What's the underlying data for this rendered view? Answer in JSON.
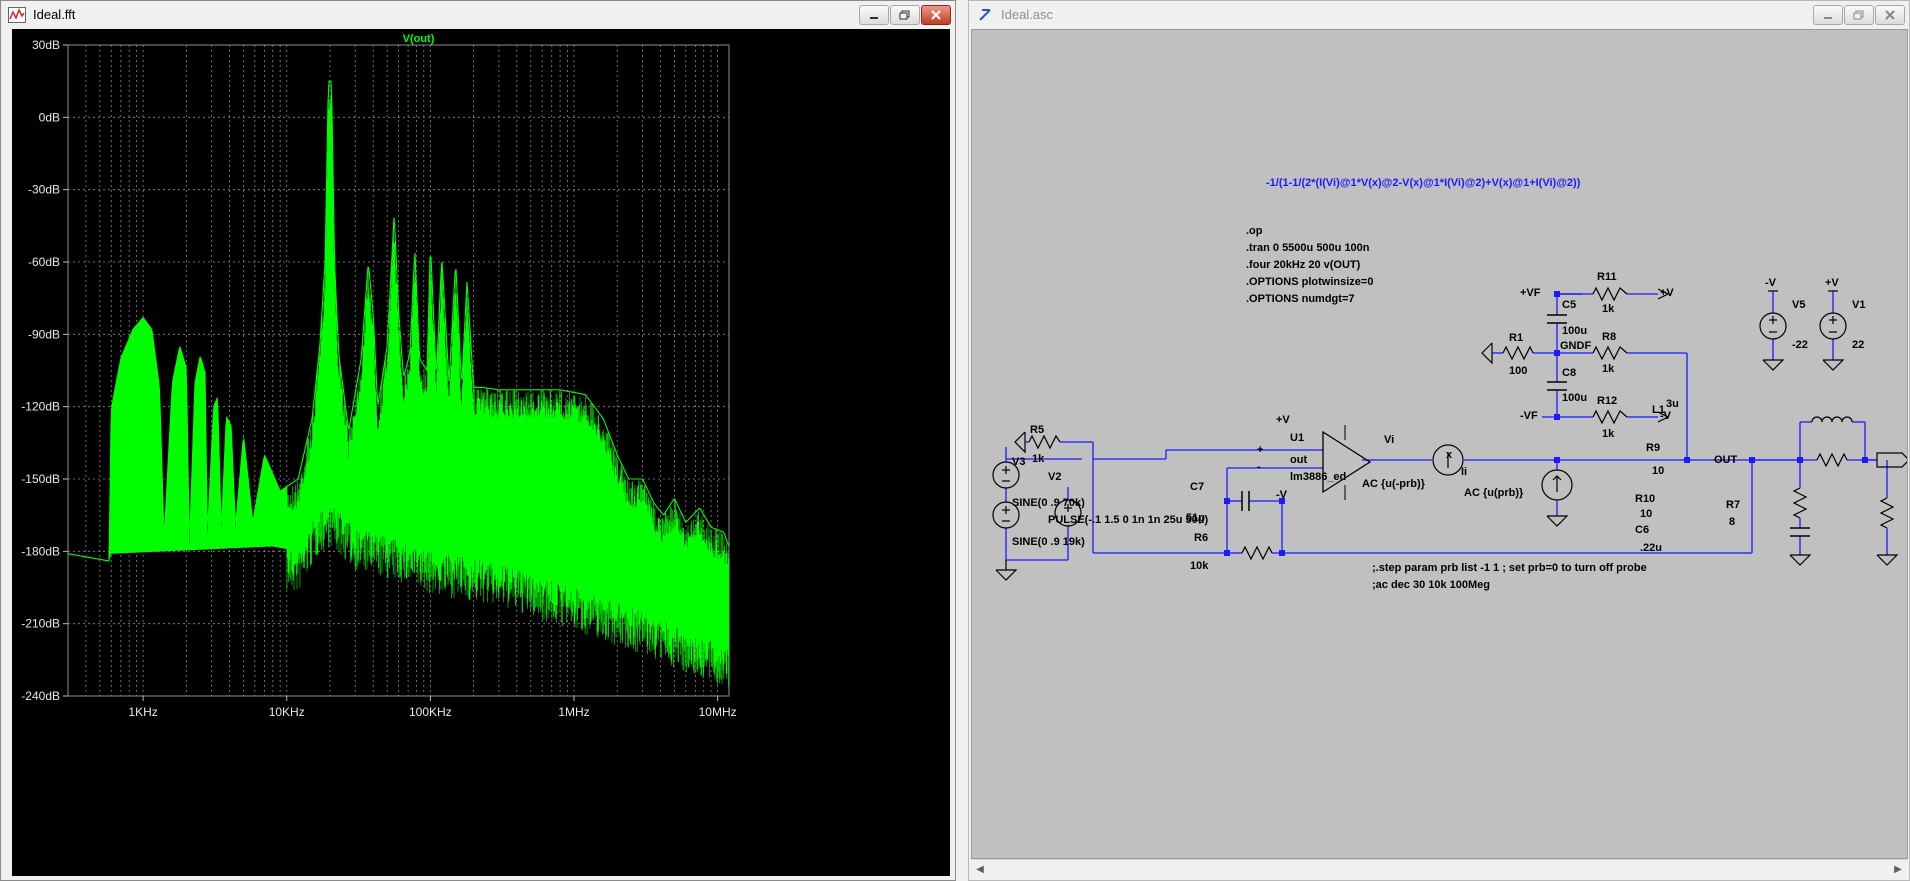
{
  "fft_window": {
    "title": "Ideal.fft",
    "icon": "waveform-icon",
    "buttons": [
      "minimize",
      "maximize",
      "close"
    ]
  },
  "schematic_window": {
    "title": "Ideal.asc",
    "icon": "ltspice-icon",
    "buttons": [
      "minimize",
      "maximize",
      "close"
    ]
  },
  "colors": {
    "trace": "#00ff00",
    "plot_bg": "#000000",
    "grid": "#808080",
    "schematic_bg": "#c0c0c0",
    "wire": "#1a1aff"
  },
  "chart_data": {
    "type": "line",
    "title": "V(out)",
    "series": [
      {
        "name": "V(out)",
        "x_unit": "Hz",
        "y_unit": "dB"
      }
    ],
    "x_scale": "log",
    "xlim": [
      300,
      12000000
    ],
    "ylim": [
      -240,
      30
    ],
    "x_ticks": [
      1000,
      10000,
      100000,
      1000000,
      10000000
    ],
    "x_tick_labels": [
      "1KHz",
      "10KHz",
      "100KHz",
      "1MHz",
      "10MHz"
    ],
    "y_ticks": [
      30,
      0,
      -30,
      -60,
      -90,
      -120,
      -150,
      -180,
      -210,
      -240
    ],
    "y_tick_labels": [
      "30dB",
      "0dB",
      "-30dB",
      "-60dB",
      "-90dB",
      "-120dB",
      "-150dB",
      "-180dB",
      "-210dB",
      "-240dB"
    ],
    "grid": true,
    "legend_placement": "top-center",
    "envelope": [
      [
        300,
        -181
      ],
      [
        580,
        -184
      ],
      [
        600,
        -121
      ],
      [
        700,
        -100
      ],
      [
        850,
        -88
      ],
      [
        1000,
        -83
      ],
      [
        1150,
        -88
      ],
      [
        1300,
        -112
      ],
      [
        1400,
        -175
      ],
      [
        1600,
        -110
      ],
      [
        1800,
        -95
      ],
      [
        2000,
        -104
      ],
      [
        2100,
        -178
      ],
      [
        2300,
        -110
      ],
      [
        2500,
        -99
      ],
      [
        2700,
        -106
      ],
      [
        2800,
        -174
      ],
      [
        3100,
        -120
      ],
      [
        3300,
        -116
      ],
      [
        3500,
        -172
      ],
      [
        3800,
        -124
      ],
      [
        4100,
        -128
      ],
      [
        4400,
        -170
      ],
      [
        5000,
        -132
      ],
      [
        5800,
        -168
      ],
      [
        7000,
        -140
      ],
      [
        9000,
        -155
      ],
      [
        12000,
        -150
      ],
      [
        15000,
        -125
      ],
      [
        17000,
        -95
      ],
      [
        18500,
        -60
      ],
      [
        19500,
        15
      ],
      [
        20500,
        15
      ],
      [
        21500,
        -60
      ],
      [
        23000,
        -98
      ],
      [
        27000,
        -130
      ],
      [
        33000,
        -100
      ],
      [
        37000,
        -60
      ],
      [
        40000,
        -82
      ],
      [
        43000,
        -120
      ],
      [
        50000,
        -95
      ],
      [
        56000,
        -40
      ],
      [
        60000,
        -80
      ],
      [
        65000,
        -108
      ],
      [
        72000,
        -98
      ],
      [
        78000,
        -55
      ],
      [
        84000,
        -100
      ],
      [
        95000,
        -105
      ],
      [
        100000,
        -52
      ],
      [
        110000,
        -108
      ],
      [
        120000,
        -58
      ],
      [
        135000,
        -110
      ],
      [
        150000,
        -60
      ],
      [
        165000,
        -112
      ],
      [
        180000,
        -68
      ],
      [
        200000,
        -112
      ],
      [
        230000,
        -112
      ],
      [
        300000,
        -113
      ],
      [
        500000,
        -113
      ],
      [
        800000,
        -113
      ],
      [
        1200000,
        -115
      ],
      [
        1600000,
        -125
      ],
      [
        2000000,
        -140
      ],
      [
        2400000,
        -150
      ],
      [
        3000000,
        -150
      ],
      [
        3600000,
        -160
      ],
      [
        4200000,
        -165
      ],
      [
        5000000,
        -158
      ],
      [
        6000000,
        -168
      ],
      [
        7500000,
        -162
      ],
      [
        9000000,
        -170
      ],
      [
        11000000,
        -172
      ],
      [
        12000000,
        -178
      ]
    ],
    "floor": [
      [
        300,
        -181
      ],
      [
        580,
        -184
      ],
      [
        600,
        -181
      ],
      [
        8000,
        -178
      ],
      [
        12000,
        -180
      ],
      [
        16000,
        -165
      ],
      [
        20000,
        -160
      ],
      [
        30000,
        -170
      ],
      [
        60000,
        -175
      ],
      [
        100000,
        -180
      ],
      [
        300000,
        -185
      ],
      [
        1000000,
        -195
      ],
      [
        3000000,
        -205
      ],
      [
        12000000,
        -220
      ]
    ]
  },
  "schematic": {
    "directives": [
      ".op",
      ".tran 0 5500u 500u 100n",
      ".four 20kHz 20 v(OUT)",
      ".OPTIONS plotwinsize=0",
      ".OPTIONS numdgt=7"
    ],
    "expression": "-1/(1-1/(2*(I(Vi)@1*V(x)@2-V(x)@1*I(Vi)@2)+V(x)@1+I(Vi)@2))",
    "comment_step": ";.step param prb list -1 1 ; set prb=0 to turn off probe",
    "comment_ac": ";ac dec 30 10k 100Meg",
    "labels": {
      "r11": "R11",
      "r11v": "1k",
      "vf_pos": "+VF",
      "v_pos": "+V",
      "c5": "C5",
      "c5v": "100u",
      "r1": "R1",
      "r1v": "100",
      "gndf": "GNDF",
      "r8": "R8",
      "r8v": "1k",
      "c8": "C8",
      "c8v": "100u",
      "r12": "R12",
      "r12v": "1k",
      "vf_neg": "-VF",
      "v_neg": "-V",
      "v5": "V5",
      "v5v": "-22",
      "v1": "V1",
      "v1v": "22",
      "v5top": "-V",
      "v1top": "+V",
      "r5": "R5",
      "r5v": "1k",
      "u1": "U1",
      "u1v": "lm3886_ed",
      "out_pin": "out",
      "plus": "+",
      "minus": "-",
      "vplus": "+V",
      "vminus": "-V",
      "vi": "Vi",
      "vi_ac": "AC {u(-prb)}",
      "x": "x",
      "ii": "Ii",
      "ii_ac": "AC {u(prb)}",
      "l1": "L1",
      "l1v": "3u",
      "r9": "R9",
      "r9v": "10",
      "out_flag": "OUT",
      "v3": "V3",
      "v3v": "SINE(0 .9 70k)",
      "v2": "V2",
      "v2v": "PULSE(-.1 1.5 0 1n 1n 25u 50u)",
      "v_sine2": "SINE(0 .9 19k)",
      "c7": "C7",
      "c7v": "51p",
      "r6": "R6",
      "r6v": "10k",
      "r10": "R10",
      "r10v": "10",
      "c6": "C6",
      "c6v": ".22u",
      "r7": "R7",
      "r7v": "8"
    }
  }
}
